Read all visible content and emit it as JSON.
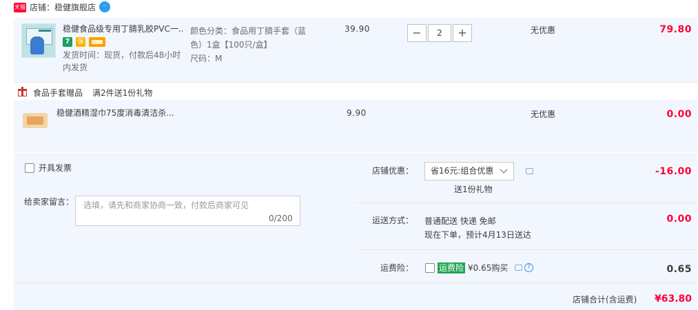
{
  "shop": {
    "badge": "天猫",
    "label": "店铺：稳健旗舰店",
    "ww_icon": "chat-bubble-icon"
  },
  "items": [
    {
      "title": "稳健食品级专用丁腈乳胶PVC一...",
      "tag_7": "7",
      "tag_b": "保",
      "ship_time": "发货时间：现货，付款后48小时内发货",
      "sku_color": "颜色分类：食品用丁腈手套（蓝色）1盒【100只/盒】",
      "sku_size": "尺码：M",
      "price": "39.90",
      "qty": "2",
      "discount": "无优惠",
      "subtotal": "79.80"
    }
  ],
  "gift": {
    "title": "食品手套赠品",
    "rule": "满2件送1份礼物",
    "item": {
      "title": "稳健酒精湿巾75度消毒清洁杀...",
      "price": "9.90",
      "discount": "无优惠",
      "subtotal": "0.00"
    }
  },
  "order": {
    "invoice_label": "开具发票",
    "message_label": "给卖家留言：",
    "message_placeholder": "选填，请先和商家协商一致，付款后商家可见",
    "message_count": "0/200",
    "shop_discount_label": "店铺优惠：",
    "shop_discount_value": "省16元:组合优惠",
    "shop_discount_note": "送1份礼物",
    "shop_discount_amount": "-16.00",
    "shipping_label": "运送方式：",
    "shipping_line1": "普通配送 快递 免邮",
    "shipping_line2": "现在下单，预计4月13日送达",
    "shipping_amount": "0.00",
    "insurance_label": "运费险：",
    "insurance_tag": "运费险",
    "insurance_price": "¥0.65购买",
    "insurance_amount": "0.65",
    "total_label": "店铺合计(含运费)",
    "total_amount": "¥63.80"
  },
  "colors": {
    "accent": "#ff0036",
    "panel": "#f2f7ff",
    "insurance_green": "#23a455"
  }
}
